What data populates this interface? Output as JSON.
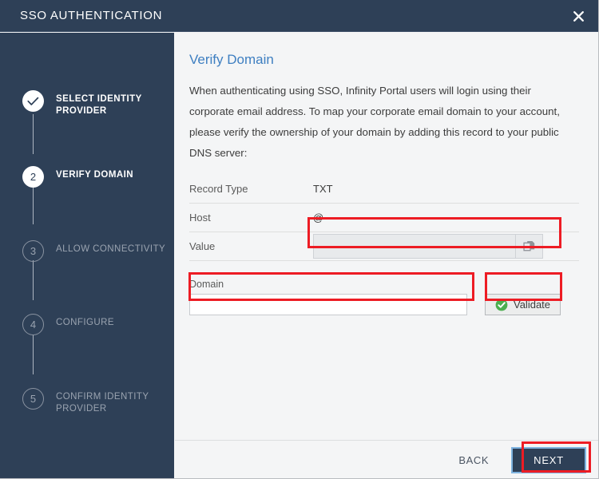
{
  "window": {
    "title": "SSO AUTHENTICATION",
    "close_icon": "close-icon"
  },
  "colors": {
    "header_bg": "#2e4057",
    "sidebar_bg": "#2e4057",
    "content_bg": "#f4f5f6",
    "accent_blue": "#3e7fc1",
    "annotation_red": "#ed1c24",
    "validate_green": "#4caf50",
    "next_focus_ring": "#7eb3e0"
  },
  "sidebar": {
    "steps": [
      {
        "number": "✓",
        "label": "SELECT IDENTITY PROVIDER",
        "state": "done"
      },
      {
        "number": "2",
        "label": "VERIFY DOMAIN",
        "state": "active"
      },
      {
        "number": "3",
        "label": "ALLOW CONNECTIVITY",
        "state": "pending"
      },
      {
        "number": "4",
        "label": "CONFIGURE",
        "state": "pending"
      },
      {
        "number": "5",
        "label": "CONFIRM IDENTITY PROVIDER",
        "state": "pending"
      }
    ]
  },
  "main": {
    "title": "Verify Domain",
    "description": "When authenticating using SSO, Infinity Portal users will login using their corporate email address. To map your corporate email domain to your account, please verify the ownership of your domain by adding this record to your public DNS server:",
    "record": {
      "rows": [
        {
          "key": "Record Type",
          "value": "TXT"
        },
        {
          "key": "Host",
          "value": "@"
        }
      ],
      "value_row": {
        "key": "Value",
        "input_value": "",
        "input_placeholder": "",
        "copy_icon": "copy-icon"
      }
    },
    "domain_field": {
      "label": "Domain",
      "value": "",
      "placeholder": ""
    },
    "validate_button": {
      "label": "Validate",
      "icon": "check-circle-icon"
    }
  },
  "footer": {
    "back_label": "BACK",
    "next_label": "NEXT"
  }
}
